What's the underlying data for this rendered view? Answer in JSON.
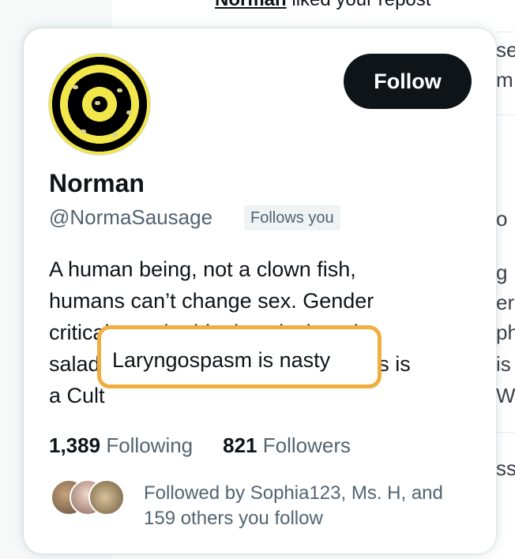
{
  "background": {
    "notification": {
      "user": "Norman",
      "action": "liked your repost"
    },
    "fragments": [
      "se",
      "m",
      "o",
      "g",
      "er",
      "ph",
      "is",
      "W",
      "ss"
    ]
  },
  "card": {
    "follow_label": "Follow",
    "name": "Norman",
    "handle": "@NormaSausage",
    "follows_you": "Follows you",
    "bio_lines": [
      "A human being, not a clown fish,",
      "humans can’t change sex. Gender",
      "critical, gender ideology is thought",
      "salad, Laryngospasm is nasty Trans is",
      "a Cult"
    ],
    "highlight_text": "Laryngospasm is nasty",
    "following_count": "1,389",
    "following_label": "Following",
    "followers_count": "821",
    "followers_label": "Followers",
    "followed_by": "Followed by Sophia123, Ms. H, and 159 others you follow"
  },
  "colors": {
    "highlight_border": "#f2ad3f",
    "follow_bg": "#0f1419",
    "avatar_yellow": "#f1e64a"
  }
}
